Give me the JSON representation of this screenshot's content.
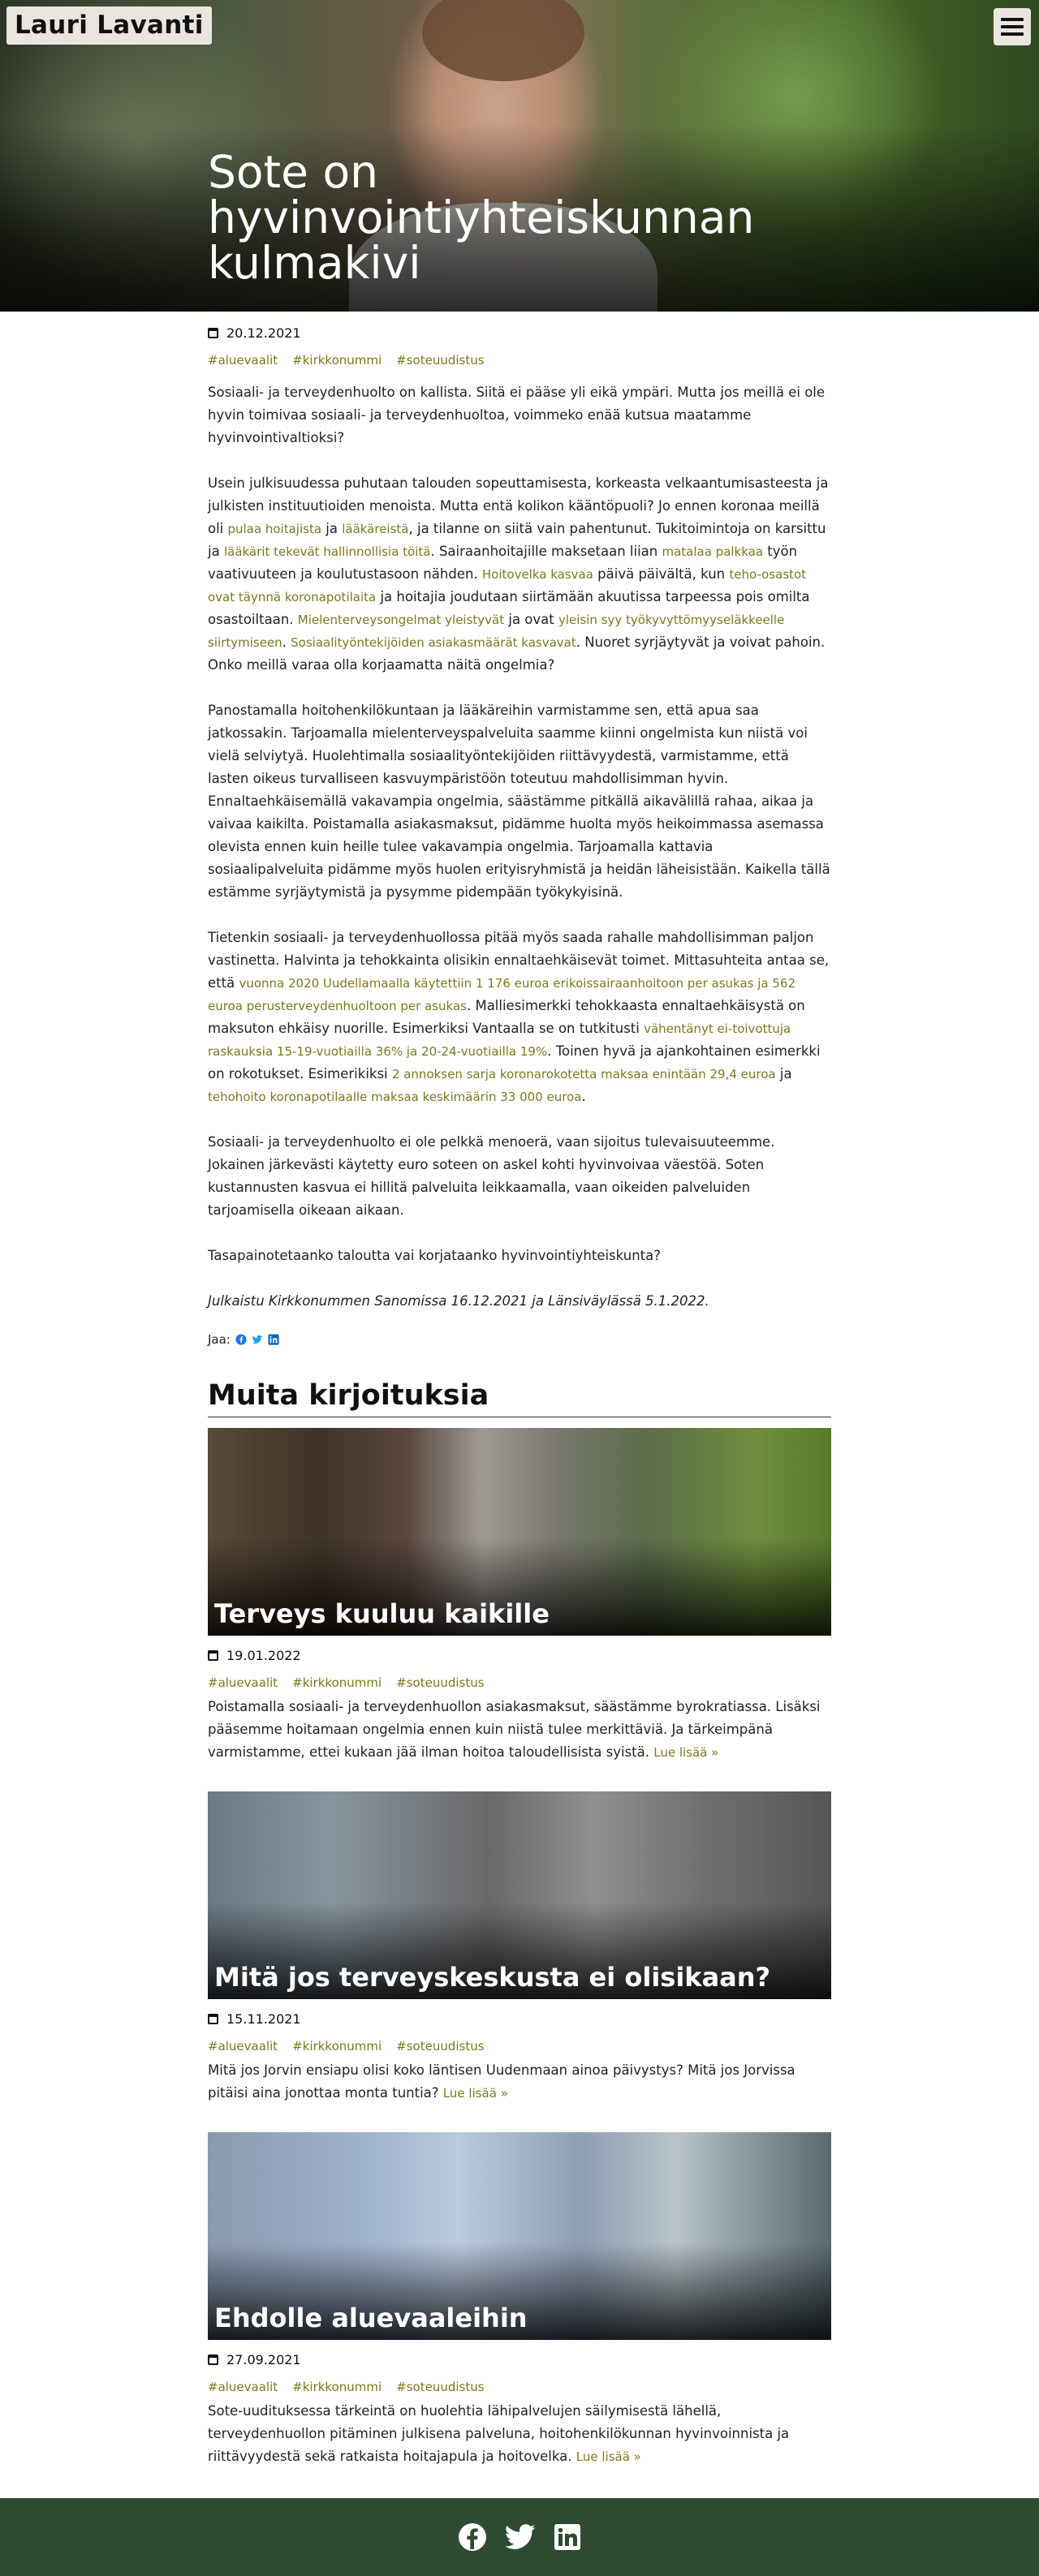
{
  "site": {
    "logo": "Lauri Lavanti"
  },
  "article": {
    "title": "Sote on hyvinvointiyhteiskunnan kulmakivi",
    "date": "20.12.2021",
    "tags": [
      "#aluevaalit",
      "#kirkkonummi",
      "#soteuudistus"
    ],
    "p1": "Sosiaali- ja terveydenhuolto on kallista. Siitä ei pääse yli eikä ympäri. Mutta jos meillä ei ole hyvin toimivaa sosiaali- ja terveydenhuoltoa, voimmeko enää kutsua maatamme hyvinvointivaltioksi?",
    "p2": {
      "t1": "Usein julkisuudessa puhutaan talouden sopeuttamisesta, korkeasta velkaantumisasteesta ja julkisten instituutioiden menoista. Mutta entä kolikon kääntöpuoli? Jo ennen koronaa meillä oli ",
      "l1": "pulaa hoitajista",
      "t2": " ja ",
      "l2": "lääkäreistä",
      "t3": ", ja tilanne on siitä vain pahentunut. Tukitoimintoja on karsittu ja ",
      "l3": "lääkärit tekevät hallinnollisia töitä",
      "t4": ". Sairaanhoitajille maksetaan liian ",
      "l4": "matalaa palkkaa",
      "t5": " työn vaativuuteen ja koulutustasoon nähden. ",
      "l5": "Hoitovelka kasvaa",
      "t6": " päivä päivältä, kun ",
      "l6": "teho-osastot ovat täynnä koronapotilaita",
      "t7": " ja hoitajia joudutaan siirtämään akuutissa tarpeessa pois omilta osastoiltaan. ",
      "l7": "Mielenterveysongelmat yleistyvät",
      "t8": " ja ovat ",
      "l8": "yleisin syy työkyvyttömyyseläkkeelle siirtymiseen",
      "t9": ". ",
      "l9": "Sosiaalityöntekijöiden asiakasmäärät kasvavat",
      "t10": ". Nuoret syrjäytyvät ja voivat pahoin. Onko meillä varaa olla korjaamatta näitä ongelmia?"
    },
    "p3": "Panostamalla hoitohenkilökuntaan ja lääkäreihin varmistamme sen, että apua saa jatkossakin. Tarjoamalla mielenterveyspalveluita saamme kiinni ongelmista kun niistä voi vielä selviytyä. Huolehtimalla sosiaalityöntekijöiden riittävyydestä, varmistamme, että lasten oikeus turvalliseen kasvuympäristöön toteutuu mahdollisimman hyvin. Ennaltaehkäisemällä vakavampia ongelmia, säästämme pitkällä aikavälillä rahaa, aikaa ja vaivaa kaikilta. Poistamalla asiakasmaksut, pidämme huolta myös heikoimmassa asemassa olevista ennen kuin heille tulee vakavampia ongelmia. Tarjoamalla kattavia sosiaalipalveluita pidämme myös huolen erityisryhmistä ja heidän läheisistään. Kaikella tällä estämme syrjäytymistä ja pysymme pidempään työkykyisinä.",
    "p4": {
      "t1": "Tietenkin sosiaali- ja terveydenhuollossa pitää myös saada rahalle mahdollisimman paljon vastinetta. Halvinta ja tehokkainta olisikin ennaltaehkäisevät toimet. Mittasuhteita antaa se, että ",
      "l1": "vuonna 2020 Uudellamaalla käytettiin 1 176 euroa erikoissairaanhoitoon per asukas ja 562 euroa perusterveydenhuoltoon per asukas",
      "t2": ". Malliesimerkki tehokkaasta ennaltaehkäisystä on maksuton ehkäisy nuorille. Esimerkiksi Vantaalla se on tutkitusti ",
      "l2": "vähentänyt ei-toivottuja raskauksia 15-19-vuotiailla 36% ja 20-24-vuotiailla 19%",
      "t3": ". Toinen hyvä ja ajankohtainen esimerkki on rokotukset. Esimerikiksi ",
      "l3": "2 annoksen sarja koronarokotetta maksaa enintään 29,4 euroa",
      "t4": " ja ",
      "l4": "tehohoito koronapotilaalle maksaa keskimäärin 33 000 euroa",
      "t5": "."
    },
    "p5": "Sosiaali- ja terveydenhuolto ei ole pelkkä menoerä, vaan sijoitus tulevaisuuteemme. Jokainen järkevästi käytetty euro soteen on askel kohti hyvinvoivaa väestöä. Soten kustannusten kasvua ei hillitä palveluita leikkaamalla, vaan oikeiden palveluiden tarjoamisella oikeaan aikaan.",
    "p6": "Tasapainotetaanko taloutta vai korjataanko hyvinvointiyhteiskunta?",
    "p7": "Julkaistu Kirkkonummen Sanomissa 16.12.2021 ja Länsiväylässä 5.1.2022.",
    "share_label": "Jaa:"
  },
  "more": {
    "heading": "Muita kirjoituksia",
    "read_more": "Lue lisää »",
    "posts": [
      {
        "title": "Terveys kuuluu kaikille",
        "date": "19.01.2022",
        "tags": [
          "#aluevaalit",
          "#kirkkonummi",
          "#soteuudistus"
        ],
        "excerpt": "Poistamalla sosiaali- ja terveydenhuollon asiakasmaksut, säästämme byrokratiassa. Lisäksi pääsemme hoitamaan ongelmia ennen kuin niistä tulee merkittäviä. Ja tärkeimpänä varmistamme, ettei kukaan jää ilman hoitoa taloudellisista syistä."
      },
      {
        "title": "Mitä jos terveyskeskusta ei olisikaan?",
        "date": "15.11.2021",
        "tags": [
          "#aluevaalit",
          "#kirkkonummi",
          "#soteuudistus"
        ],
        "excerpt": "Mitä jos Jorvin ensiapu olisi koko läntisen Uudenmaan ainoa päivystys? Mitä jos Jorvissa pitäisi aina jonottaa monta tuntia?"
      },
      {
        "title": "Ehdolle aluevaaleihin",
        "date": "27.09.2021",
        "tags": [
          "#aluevaalit",
          "#kirkkonummi",
          "#soteuudistus"
        ],
        "excerpt": "Sote-uudituksessa tärkeintä on huolehtia lähipalvelujen säilymisestä lähellä, terveydenhuollon pitäminen julkisena palveluna, hoitohenkilökunnan hyvinvoinnista ja riittävyydestä sekä ratkaista hoitajapula ja hoitovelka."
      }
    ]
  },
  "colors": {
    "tag": "#7b7a1e",
    "footer": "#2e4a33",
    "facebook": "#1877f2",
    "twitter": "#1da1f2",
    "linkedin": "#0a66c2"
  },
  "icons": [
    "menu-icon",
    "calendar-icon",
    "facebook-icon",
    "twitter-icon",
    "linkedin-icon"
  ]
}
